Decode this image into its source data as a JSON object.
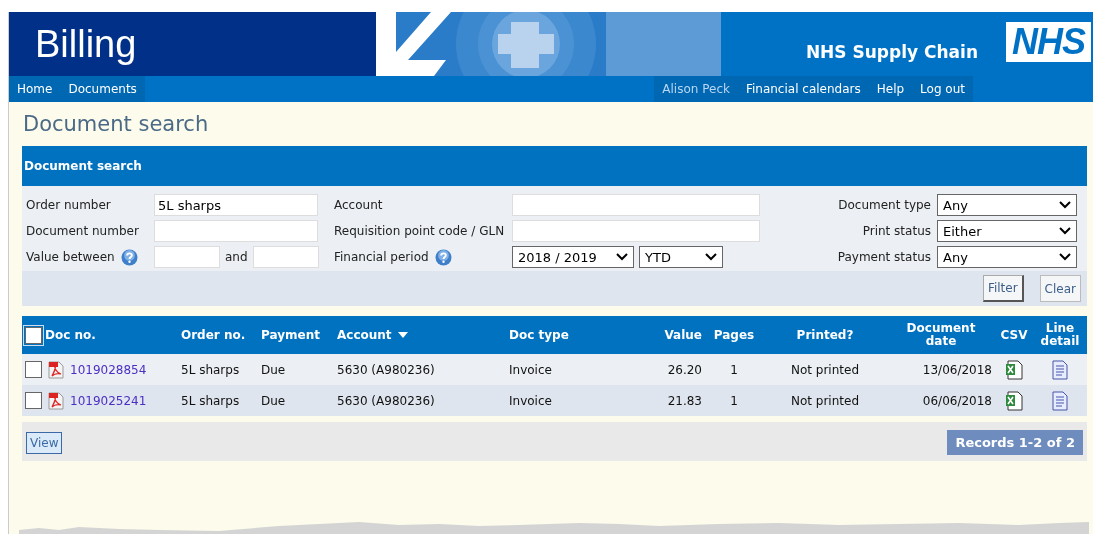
{
  "header": {
    "title": "Billing",
    "brand": "NHS Supply Chain",
    "logo": "NHS"
  },
  "nav": {
    "left": [
      {
        "label": "Home"
      },
      {
        "label": "Documents"
      }
    ],
    "right": [
      {
        "label": "Alison Peck",
        "kind": "user"
      },
      {
        "label": "Financial calendars",
        "kind": "link"
      },
      {
        "label": "Help",
        "kind": "link"
      },
      {
        "label": "Log out",
        "kind": "link"
      }
    ]
  },
  "page_title": "Document search",
  "search": {
    "title": "Document search",
    "rows": [
      [
        {
          "label": "Order number",
          "kind": "text",
          "value": "5L sharps"
        },
        {
          "label": "Account",
          "kind": "text"
        },
        {
          "label": "Document type",
          "kind": "select",
          "value": "Any"
        }
      ],
      [
        {
          "label": "Document number",
          "kind": "text"
        },
        {
          "label": "Requisition point code / GLN",
          "kind": "text"
        },
        {
          "label": "Print status",
          "kind": "select",
          "value": "Either"
        }
      ],
      [
        {
          "label": "Value between",
          "kind": "range",
          "joiner": "and",
          "help": true
        },
        {
          "label": "Financial period",
          "kind": "period",
          "values": [
            "2018 / 2019",
            "YTD"
          ],
          "help": true
        },
        {
          "label": "Payment status",
          "kind": "select",
          "value": "Any"
        }
      ]
    ],
    "buttons": [
      "Filter",
      "Clear"
    ]
  },
  "table": {
    "select_all": {
      "checked": false
    },
    "columns": [
      {
        "label": "Doc no."
      },
      {
        "label": "Order no."
      },
      {
        "label": "Payment"
      },
      {
        "label": "Account",
        "sorted": true
      },
      {
        "label": "Doc type"
      },
      {
        "label": "Value"
      },
      {
        "label": "Pages"
      },
      {
        "label": "Printed?"
      },
      {
        "label": "Document date"
      },
      {
        "label": "CSV"
      },
      {
        "label": "Line detail"
      }
    ],
    "rows": [
      {
        "checked": false,
        "doc_no": "1019028854",
        "order_no": "5L sharps",
        "payment": "Due",
        "account": "5630 (A980236)",
        "doc_type": "Invoice",
        "value": "26.20",
        "pages": "1",
        "printed": "Not printed",
        "date": "13/06/2018"
      },
      {
        "checked": false,
        "doc_no": "1019025241",
        "order_no": "5L sharps",
        "payment": "Due",
        "account": "5630 (A980236)",
        "doc_type": "Invoice",
        "value": "21.83",
        "pages": "1",
        "printed": "Not printed",
        "date": "06/06/2018"
      }
    ],
    "view_button": "View",
    "records": "Records 1-2 of 2"
  }
}
